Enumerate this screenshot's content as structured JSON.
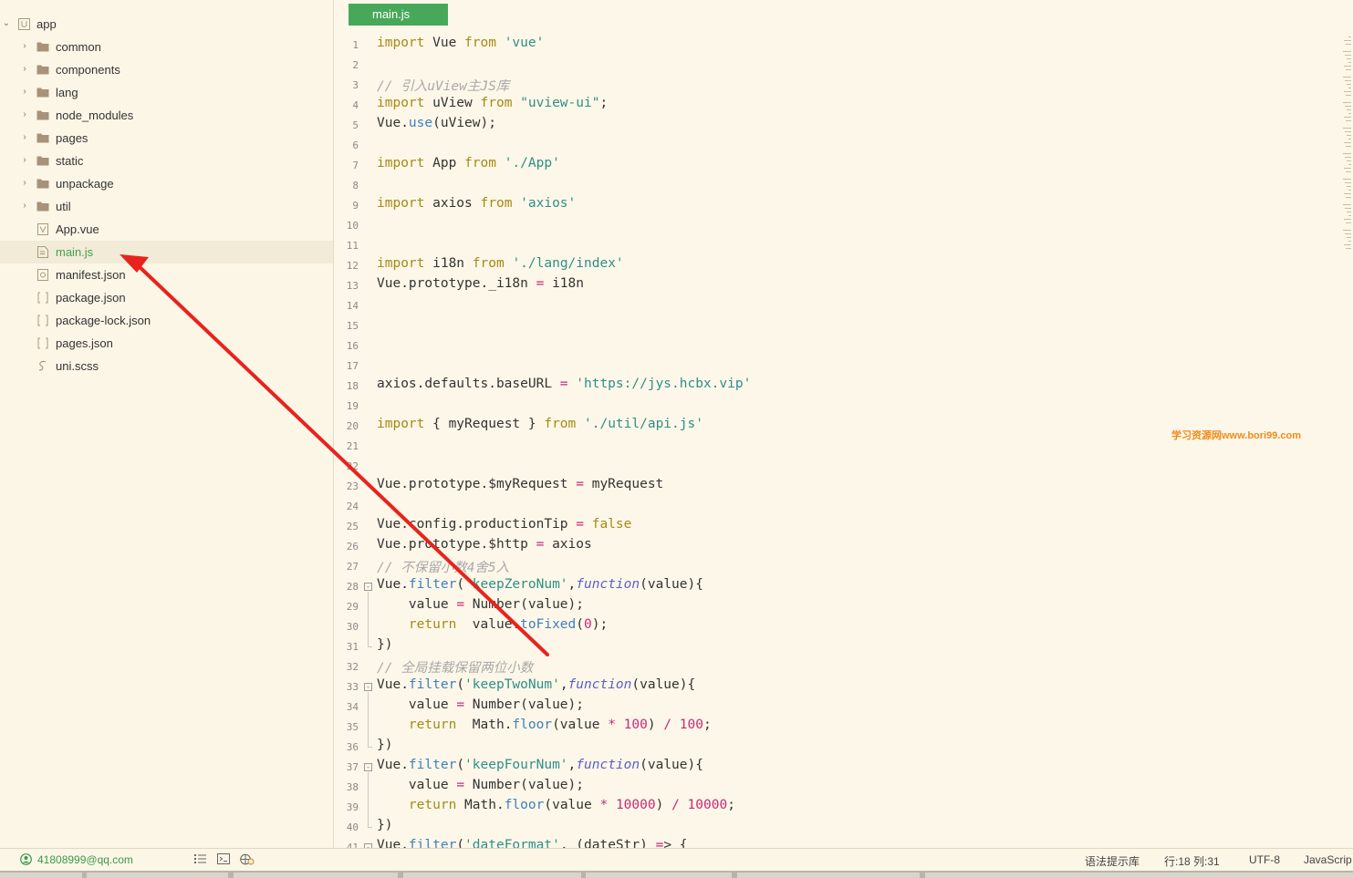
{
  "sidebar": {
    "root": {
      "label": "app",
      "icon": "project-folder-icon"
    },
    "items": [
      {
        "label": "common",
        "icon": "folder-icon",
        "type": "folder"
      },
      {
        "label": "components",
        "icon": "folder-icon",
        "type": "folder"
      },
      {
        "label": "lang",
        "icon": "folder-icon",
        "type": "folder"
      },
      {
        "label": "node_modules",
        "icon": "folder-icon",
        "type": "folder"
      },
      {
        "label": "pages",
        "icon": "folder-icon",
        "type": "folder"
      },
      {
        "label": "static",
        "icon": "folder-icon",
        "type": "folder"
      },
      {
        "label": "unpackage",
        "icon": "folder-icon",
        "type": "folder"
      },
      {
        "label": "util",
        "icon": "folder-icon",
        "type": "folder"
      },
      {
        "label": "App.vue",
        "icon": "vue-file-icon",
        "type": "file"
      },
      {
        "label": "main.js",
        "icon": "js-file-icon",
        "type": "file",
        "selected": true
      },
      {
        "label": "manifest.json",
        "icon": "manifest-file-icon",
        "type": "file"
      },
      {
        "label": "package.json",
        "icon": "json-file-icon",
        "type": "file"
      },
      {
        "label": "package-lock.json",
        "icon": "json-file-icon",
        "type": "file"
      },
      {
        "label": "pages.json",
        "icon": "json-file-icon",
        "type": "file"
      },
      {
        "label": "uni.scss",
        "icon": "scss-file-icon",
        "type": "file"
      }
    ]
  },
  "editor": {
    "tab": "main.js",
    "lines": [
      "import Vue from 'vue'",
      "",
      "// 引入uView主JS库",
      "import uView from \"uview-ui\";",
      "Vue.use(uView);",
      "",
      "import App from './App'",
      "",
      "import axios from 'axios'",
      "",
      "",
      "import i18n from './lang/index'",
      "Vue.prototype._i18n = i18n",
      "",
      "",
      "",
      "",
      "axios.defaults.baseURL = 'https://jys.hcbx.vip'",
      "",
      "import { myRequest } from './util/api.js'",
      "",
      "",
      "Vue.prototype.$myRequest = myRequest",
      "",
      "Vue.config.productionTip = false",
      "Vue.prototype.$http = axios",
      "// 不保留小数4舍5入",
      "Vue.filter('keepZeroNum',function(value){",
      "    value = Number(value);",
      "    return  value.toFixed(0);",
      "})",
      "// 全局挂载保留两位小数",
      "Vue.filter('keepTwoNum',function(value){",
      "    value = Number(value);",
      "    return  Math.floor(value * 100) / 100;",
      "})",
      "Vue.filter('keepFourNum',function(value){",
      "    value = Number(value);",
      "    return Math.floor(value * 10000) / 10000;",
      "})",
      "Vue.filter('dateFormat', (dateStr) => {"
    ]
  },
  "watermark": "学习资源网www.bori99.com",
  "statusbar": {
    "account": "41808999@qq.com",
    "hint_lib": "语法提示库",
    "position": "行:18   列:31",
    "encoding": "UTF-8",
    "language": "JavaScrip"
  },
  "colors": {
    "accent": "#48a85a",
    "annotation_arrow": "#e8231d",
    "background": "#fdf7e9"
  }
}
